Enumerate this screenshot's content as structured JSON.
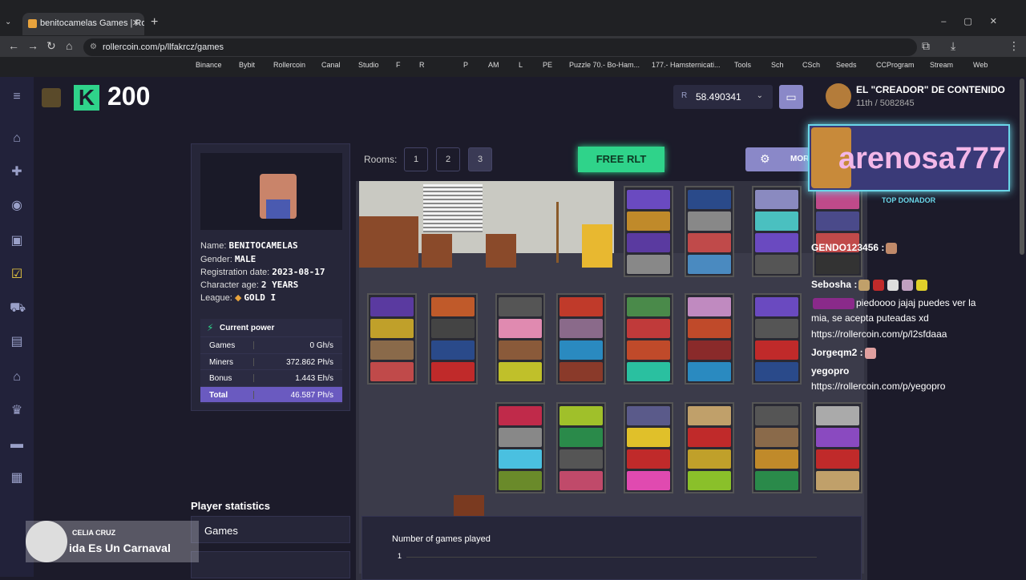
{
  "browser": {
    "tab_title": "benitocamelas Games | Rollerco",
    "url": "rollercoin.com/p/llfakrcz/games",
    "bookmarks": [
      "Binance",
      "Bybit",
      "Rollercoin",
      "Canal",
      "Studio",
      "F",
      "R",
      "P",
      "AM",
      "L",
      "PE",
      "Puzzle 70.- Bo-Ham...",
      "177.- Hamsternicati...",
      "Tools",
      "Sch",
      "CSch",
      "Seeds",
      "CCProgram",
      "Stream",
      "Web"
    ]
  },
  "header": {
    "level": "200",
    "balance": "58.490341",
    "balance_currency": "R",
    "user_name": "EL \"CREADOR\" DE CONTENIDO",
    "user_rank": "11th / 5082845"
  },
  "profile": {
    "name_label": "Name:",
    "name": "BENITOCAMELAS",
    "gender_label": "Gender:",
    "gender": "MALE",
    "reg_label": "Registration date:",
    "reg": "2023-08-17",
    "age_label": "Character age:",
    "age": "2 YEARS",
    "league_label": "League:",
    "league": "GOLD I",
    "power": {
      "title": "Current power",
      "rows": [
        {
          "label": "Games",
          "value": "0 Gh/s"
        },
        {
          "label": "Miners",
          "value": "372.862 Ph/s"
        },
        {
          "label": "Bonus",
          "value": "1.443 Eh/s"
        },
        {
          "label": "Total",
          "value": "46.587 Ph/s"
        }
      ]
    }
  },
  "rooms": {
    "label": "Rooms:",
    "items": [
      "1",
      "2",
      "3"
    ],
    "active": "3",
    "free_button": "FREE RLT",
    "more_button": "MORE"
  },
  "stats": {
    "title": "Player statistics",
    "games_tab": "Games",
    "chart_title": "Number of games played",
    "chart_y_tick": "1"
  },
  "chat": {
    "donor_name": "arenosa777",
    "donor_label": "TOP DONADOR",
    "messages": [
      {
        "user": "GENDO123456 :",
        "text": ""
      },
      {
        "user": "Sebosha :",
        "text": ""
      },
      {
        "user": "",
        "text": "piedoooo jajaj puedes ver la"
      },
      {
        "user": "",
        "text": "mia, se acepta puteadas xd"
      },
      {
        "user": "",
        "text": "https://rollercoin.com/p/l2sfdaaa"
      },
      {
        "user": "Jorgeqm2 :",
        "text": ""
      },
      {
        "user": "yegopro",
        "text": ""
      },
      {
        "user": "",
        "text": "https://rollercoin.com/p/yegopro"
      }
    ]
  },
  "music": {
    "artist": "CELIA CRUZ",
    "song": "ida Es Un Carnaval"
  },
  "colors": {
    "accent": "#2fd38a",
    "purple": "#8a88c8",
    "bg": "#1c1b2a"
  }
}
